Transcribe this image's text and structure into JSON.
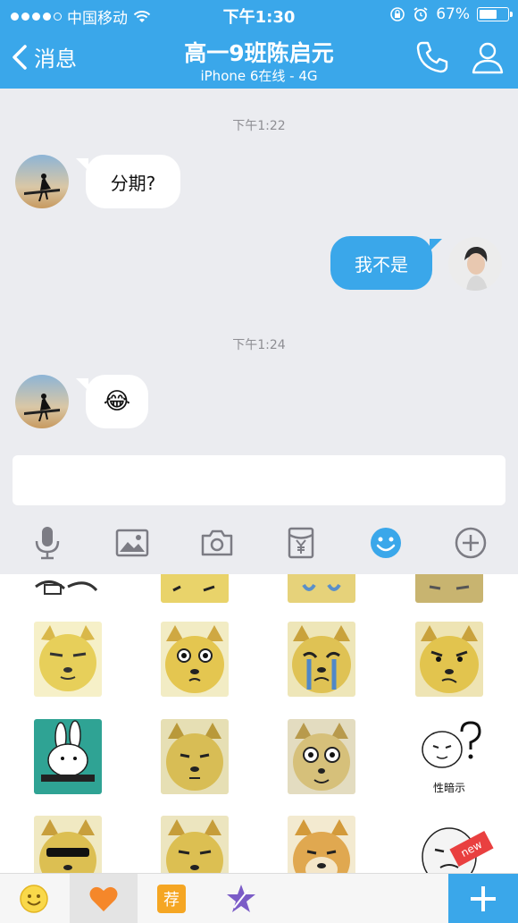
{
  "status_bar": {
    "carrier": "中国移动",
    "time": "下午1:30",
    "battery_percent": "67%",
    "battery_level": 0.67,
    "signal_bars": 4,
    "icons": [
      "wifi-icon",
      "rotation-lock-icon",
      "alarm-icon",
      "battery-icon"
    ]
  },
  "header": {
    "back_label": "消息",
    "title": "高一9班陈启元",
    "subtitle": "iPhone 6在线 - 4G",
    "icons": [
      "back-chevron-icon",
      "phone-icon",
      "profile-icon"
    ]
  },
  "chat": {
    "messages": [
      {
        "type": "timestamp",
        "text": "下午1:22"
      },
      {
        "type": "incoming",
        "text": "分期?"
      },
      {
        "type": "outgoing",
        "text": "我不是"
      },
      {
        "type": "timestamp",
        "text": "下午1:24"
      },
      {
        "type": "incoming",
        "text": "😂"
      }
    ]
  },
  "input": {
    "value": "",
    "placeholder": ""
  },
  "toolbar": {
    "icons": [
      "microphone-icon",
      "image-icon",
      "camera-icon",
      "red-packet-icon",
      "emoji-icon",
      "plus-circle-icon"
    ],
    "active": "emoji-icon"
  },
  "stickers": {
    "grid_columns": 4,
    "labeled_sticker_text": "性暗示",
    "new_badge": "new"
  },
  "bottom_bar": {
    "tabs": [
      "smiley-icon",
      "heart-icon",
      "recommend-icon",
      "star-icon"
    ],
    "recommend_label": "荐",
    "active_tab": "heart-icon",
    "add_button": "plus-icon"
  },
  "colors": {
    "accent": "#3aa7ea",
    "chat_background": "#ebecf0",
    "heart": "#f5872a",
    "recommend": "#f5a623",
    "star": "#7b5cc7",
    "new_badge": "#e94040"
  }
}
